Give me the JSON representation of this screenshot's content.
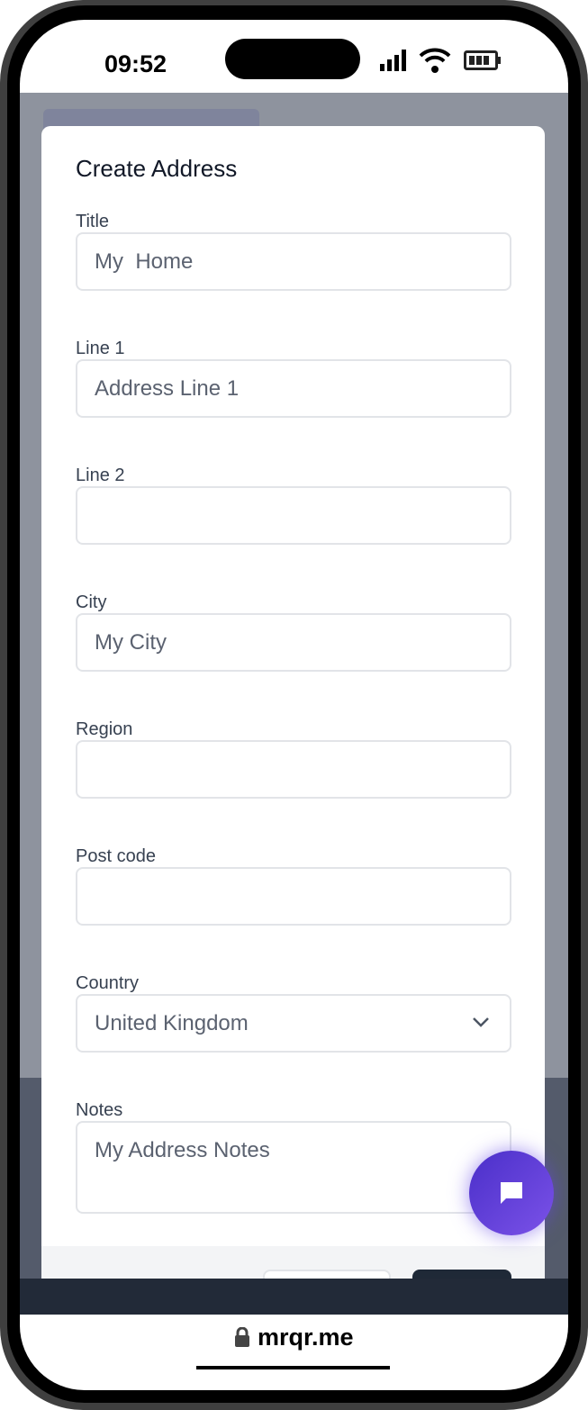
{
  "status_bar": {
    "time": "09:52",
    "icons": [
      "signal-icon",
      "wifi-icon",
      "battery-icon"
    ]
  },
  "modal": {
    "title": "Create Address",
    "fields": [
      {
        "label": "Title",
        "value": "My  Home"
      },
      {
        "label": "Line 1",
        "value": "Address Line 1"
      },
      {
        "label": "Line 2",
        "value": ""
      },
      {
        "label": "City",
        "value": "My City"
      },
      {
        "label": "Region",
        "value": ""
      },
      {
        "label": "Post code",
        "value": ""
      },
      {
        "label": "Country",
        "value": "United Kingdom"
      },
      {
        "label": "Notes",
        "value": "My Address Notes"
      }
    ]
  },
  "browser": {
    "url": "mrqr.me",
    "lock_icon": "lock-icon"
  },
  "chat_button": {
    "icon": "chat-bubble-icon",
    "color": "#5b3bd6"
  }
}
